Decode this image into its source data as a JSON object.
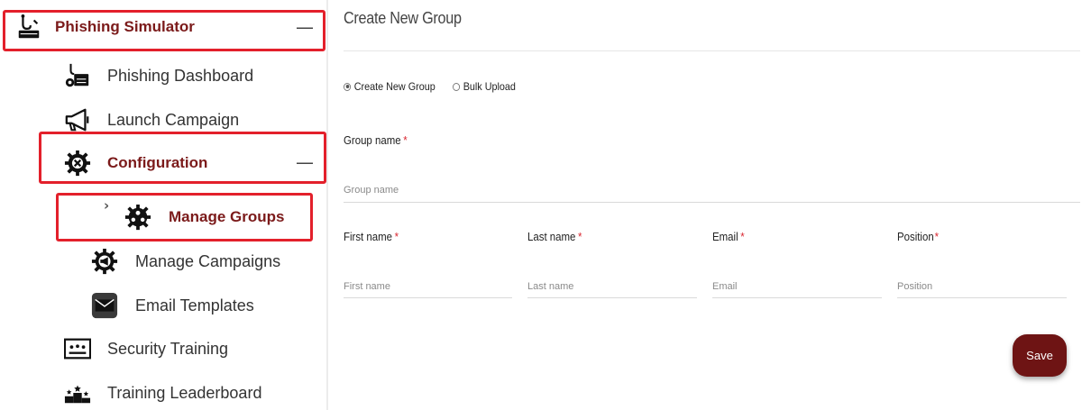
{
  "sidebar": {
    "items": [
      {
        "label": "Phishing Simulator",
        "icon": "phishing-hook-icon",
        "expanded": true
      },
      {
        "label": "Phishing Dashboard",
        "icon": "phishing-dashboard-icon"
      },
      {
        "label": "Launch Campaign",
        "icon": "megaphone-icon"
      },
      {
        "label": "Configuration",
        "icon": "gear-wrench-icon",
        "expanded": true
      },
      {
        "label": "Manage Groups",
        "icon": "gear-group-icon",
        "active": true
      },
      {
        "label": "Manage Campaigns",
        "icon": "gear-megaphone-icon"
      },
      {
        "label": "Email Templates",
        "icon": "envelope-icon"
      },
      {
        "label": "Security Training",
        "icon": "presentation-icon"
      },
      {
        "label": "Training Leaderboard",
        "icon": "podium-icon"
      }
    ],
    "collapse_symbol": "—",
    "active_marker": "›"
  },
  "main": {
    "title": "Create New Group",
    "mode_options": [
      {
        "label": "Create New Group",
        "selected": true
      },
      {
        "label": "Bulk Upload",
        "selected": false
      }
    ],
    "group_name": {
      "label": "Group name",
      "required_mark": "*",
      "placeholder": "Group name",
      "value": ""
    },
    "member_fields": [
      {
        "label": "First name",
        "required_mark": "*",
        "placeholder": "First name"
      },
      {
        "label": "Last name",
        "required_mark": "*",
        "placeholder": "Last name"
      },
      {
        "label": "Email",
        "required_mark": "*",
        "placeholder": "Email"
      },
      {
        "label": "Position",
        "required_mark": "*",
        "placeholder": "Position"
      }
    ],
    "save_label": "Save"
  },
  "colors": {
    "brand": "#7b1a1a",
    "highlight": "#e3202b",
    "required": "#d9232d",
    "save_button": "#6e1414"
  }
}
